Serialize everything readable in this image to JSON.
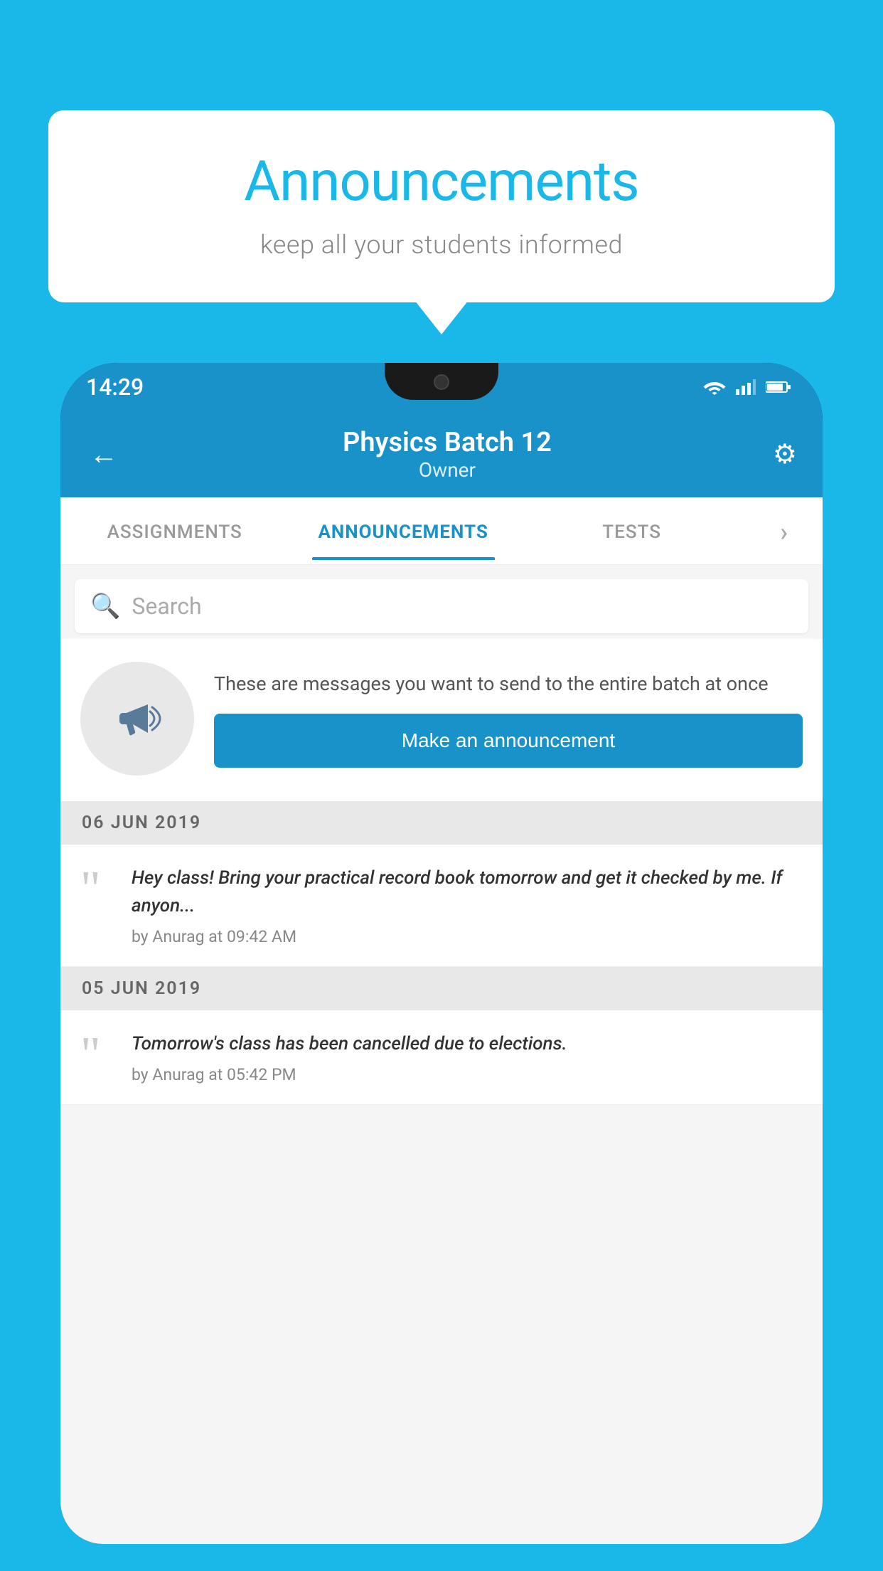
{
  "background_color": "#1ab8e8",
  "bubble": {
    "title": "Announcements",
    "subtitle": "keep all your students informed"
  },
  "header": {
    "batch_name": "Physics Batch 12",
    "role": "Owner",
    "back_label": "←",
    "settings_label": "⚙"
  },
  "tabs": [
    {
      "label": "ASSIGNMENTS",
      "active": false
    },
    {
      "label": "ANNOUNCEMENTS",
      "active": true
    },
    {
      "label": "TESTS",
      "active": false
    },
    {
      "label": "·",
      "active": false
    }
  ],
  "search": {
    "placeholder": "Search"
  },
  "promo": {
    "description": "These are messages you want to send to the entire batch at once",
    "button_label": "Make an announcement"
  },
  "announcements": [
    {
      "date": "06  JUN  2019",
      "text": "Hey class! Bring your practical record book tomorrow and get it checked by me. If anyon...",
      "meta": "by Anurag at 09:42 AM"
    },
    {
      "date": "05  JUN  2019",
      "text": "Tomorrow's class has been cancelled due to elections.",
      "meta": "by Anurag at 05:42 PM"
    }
  ],
  "status_bar": {
    "time": "14:29"
  },
  "icons": {
    "search": "🔍",
    "back": "←",
    "settings": "⚙",
    "quote": "“"
  }
}
